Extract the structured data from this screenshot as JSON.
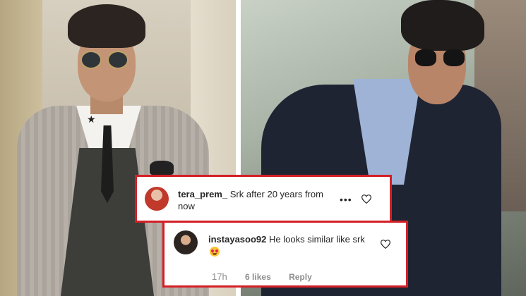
{
  "photos": {
    "left": {
      "icon": "person-in-checked-suit-photo"
    },
    "right": {
      "icon": "person-in-dark-suit-photo"
    }
  },
  "comments": [
    {
      "username": "tera_prem_",
      "text": "Srk after 20 years from now",
      "actions": {
        "more_label": "•••",
        "like_icon": "heart-icon"
      }
    },
    {
      "username": "instayasoo92",
      "text": "He looks similar like srk",
      "emoji": "heart-eyes-emoji",
      "meta": {
        "time": "17h",
        "likes": "6 likes",
        "reply_label": "Reply"
      },
      "actions": {
        "like_icon": "heart-icon"
      }
    }
  ],
  "colors": {
    "highlight_border": "#d41f26",
    "text": "#262626",
    "meta": "#8e8e8e"
  }
}
